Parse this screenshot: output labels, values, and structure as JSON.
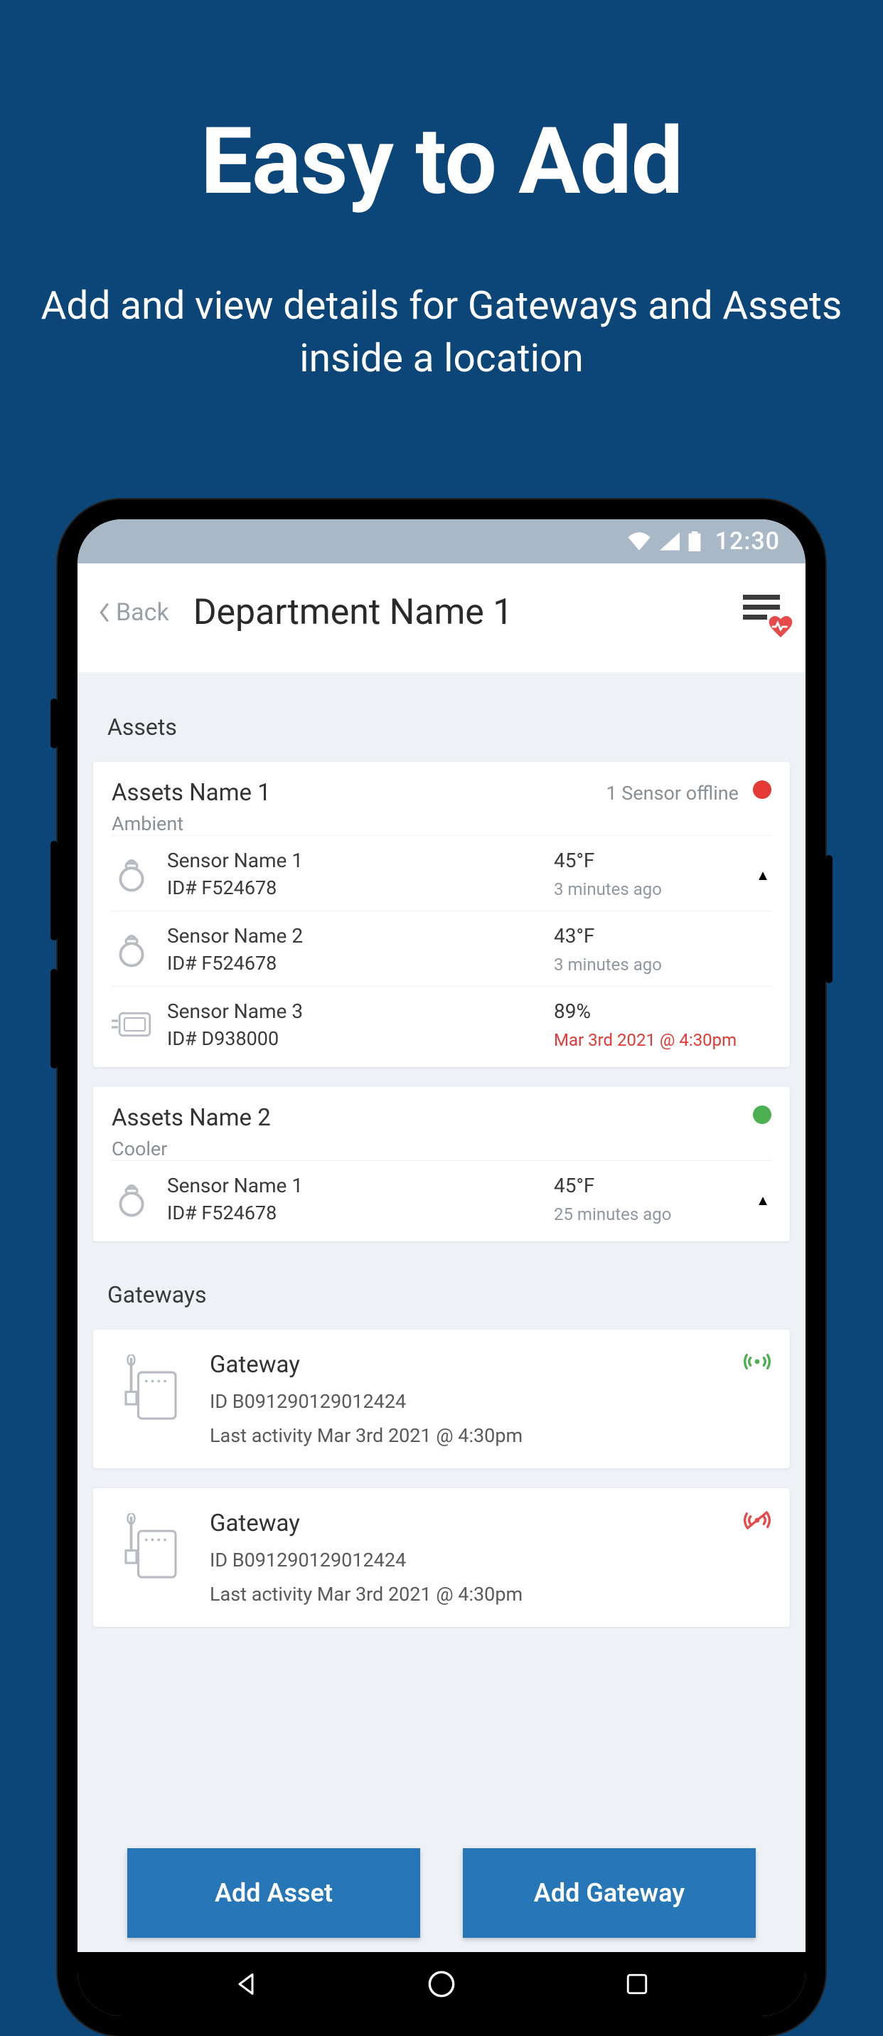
{
  "hero": {
    "title": "Easy to Add",
    "subtitle": "Add and view details for Gateways and Assets inside a location"
  },
  "statusBar": {
    "time": "12:30"
  },
  "header": {
    "back": "Back",
    "title": "Department Name 1"
  },
  "sections": {
    "assetsLabel": "Assets",
    "gatewaysLabel": "Gateways"
  },
  "assets": [
    {
      "name": "Assets Name 1",
      "subtype": "Ambient",
      "statusText": "1 Sensor offline",
      "statusColor": "red",
      "sensors": [
        {
          "name": "Sensor Name 1",
          "id": "ID# F524678",
          "value": "45°F",
          "time": "3 minutes ago",
          "alert": false,
          "iconType": "ring"
        },
        {
          "name": "Sensor Name 2",
          "id": "ID# F524678",
          "value": "43°F",
          "time": "3 minutes ago",
          "alert": false,
          "iconType": "ring"
        },
        {
          "name": "Sensor Name 3",
          "id": "ID# D938000",
          "value": "89%",
          "time": "Mar 3rd 2021 @ 4:30pm",
          "alert": true,
          "iconType": "box"
        }
      ]
    },
    {
      "name": "Assets Name 2",
      "subtype": "Cooler",
      "statusText": "",
      "statusColor": "green",
      "sensors": [
        {
          "name": "Sensor Name 1",
          "id": "ID# F524678",
          "value": "45°F",
          "time": "25 minutes ago",
          "alert": false,
          "iconType": "ring"
        }
      ]
    }
  ],
  "gateways": [
    {
      "name": "Gateway",
      "id": "ID B091290129012424",
      "activity": "Last activity Mar 3rd 2021 @ 4:30pm",
      "online": true
    },
    {
      "name": "Gateway",
      "id": "ID B091290129012424",
      "activity": "Last activity Mar 3rd 2021 @ 4:30pm",
      "online": false
    }
  ],
  "buttons": {
    "addAsset": "Add Asset",
    "addGateway": "Add Gateway"
  }
}
